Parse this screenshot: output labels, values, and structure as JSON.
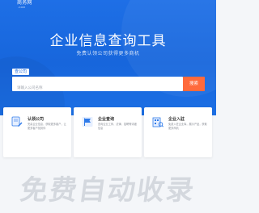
{
  "header": {
    "logo_text": "商务网",
    "logo_sub": ".COM"
  },
  "hero": {
    "title": "企业信息查询工具",
    "subtitle": "免费认领公司获得更多商机"
  },
  "search": {
    "tab_label": "查公司",
    "placeholder": "请输入公司名称",
    "button_label": "搜索"
  },
  "cards": [
    {
      "title": "认领公司",
      "desc": "完善企业信息，获取更多客户，让更多客户找到你",
      "icon": "pencil-icon"
    },
    {
      "title": "企业查询",
      "desc": "查询企业工商、法律、招聘等详细信息",
      "icon": "flag-icon"
    },
    {
      "title": "企业入驻",
      "desc": "免费入驻企业库，展示产品，获取更多商机",
      "icon": "building-icon"
    }
  ],
  "watermark": "免费自动收录",
  "colors": {
    "hero_blue": "#1766dc",
    "search_button": "#ff6a3c",
    "background": "#f4f6f9"
  }
}
